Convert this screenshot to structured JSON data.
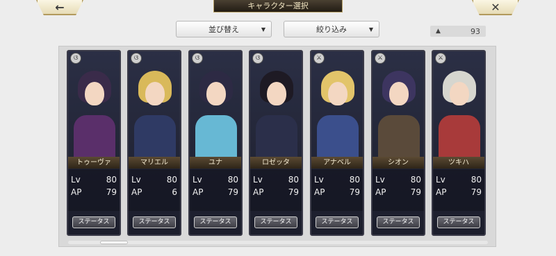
{
  "header": {
    "back_icon": "back-arrow-icon",
    "back_glyph": "←",
    "title": "キャラクター選択",
    "close_icon": "close-icon",
    "close_glyph": "✕"
  },
  "controls": {
    "sort_label": "並び替え",
    "filter_label": "絞り込み",
    "caret": "▼",
    "owned_count": "93",
    "person_glyph": "▲"
  },
  "characters": [
    {
      "name": "トゥーヴァ",
      "lv_label": "Lv",
      "lv": "80",
      "ap_label": "AP",
      "ap": "79",
      "badge": "ଓ",
      "status": "ステータス",
      "hair": "#3a2b4a",
      "body": "#5a2f6a"
    },
    {
      "name": "マリエル",
      "lv_label": "Lv",
      "lv": "80",
      "ap_label": "AP",
      "ap": "6",
      "badge": "ଓ",
      "status": "ステータス",
      "hair": "#d9b95a",
      "body": "#2f3a64"
    },
    {
      "name": "ユナ",
      "lv_label": "Lv",
      "lv": "80",
      "ap_label": "AP",
      "ap": "79",
      "badge": "ଓ",
      "status": "ステータス",
      "hair": "#2d2a44",
      "body": "#67b8d4"
    },
    {
      "name": "ロゼッタ",
      "lv_label": "Lv",
      "lv": "80",
      "ap_label": "AP",
      "ap": "79",
      "badge": "ଓ",
      "status": "ステータス",
      "hair": "#1e1a24",
      "body": "#2b2f4a"
    },
    {
      "name": "アナベル",
      "lv_label": "Lv",
      "lv": "80",
      "ap_label": "AP",
      "ap": "79",
      "badge": "⚔",
      "status": "ステータス",
      "hair": "#e2c46a",
      "body": "#3b4f8c"
    },
    {
      "name": "シオン",
      "lv_label": "Lv",
      "lv": "80",
      "ap_label": "AP",
      "ap": "79",
      "badge": "⚔",
      "status": "ステータス",
      "hair": "#3d3560",
      "body": "#5a4a3a"
    },
    {
      "name": "ツキハ",
      "lv_label": "Lv",
      "lv": "80",
      "ap_label": "AP",
      "ap": "79",
      "badge": "⚔",
      "status": "ステータス",
      "hair": "#d6d6cf",
      "body": "#a83a3a"
    }
  ]
}
